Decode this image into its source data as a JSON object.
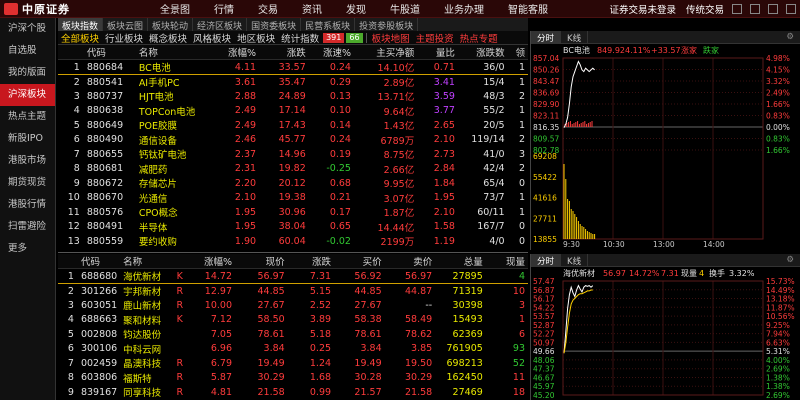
{
  "app": {
    "logo_text": "中原证券",
    "menu": [
      "全景图",
      "行情",
      "交易",
      "资讯",
      "发现",
      "牛股道",
      "业务办理",
      "智能客服"
    ],
    "status": "证券交易未登录",
    "theme": "传统交易"
  },
  "subtabs": [
    "板块指数",
    "板块云图",
    "板块轮动",
    "经济区板块",
    "国资委板块",
    "民营系板块",
    "投资参股板块"
  ],
  "sidebar": [
    "沪深个股",
    "自选股",
    "我的版面",
    "沪深板块",
    "热点主题",
    "新股IPO",
    "港股市场",
    "期货现货",
    "港股行情",
    "扫雷避险",
    "更多"
  ],
  "categories": {
    "items": [
      "全部板块",
      "行业板块",
      "概念板块",
      "风格板块",
      "地区板块",
      "统计指数"
    ],
    "up_count": "391",
    "down_count": "66",
    "extra": [
      "板块地图",
      "主题投资",
      "热点专题"
    ]
  },
  "upper_table": {
    "headers": [
      "",
      "代码",
      "名称",
      "涨幅%",
      "涨跌",
      "涨速%",
      "主买净额",
      "量比",
      "涨跌数",
      "领"
    ],
    "rows": [
      [
        "1",
        "880684",
        "BC电池",
        "4.11",
        "33.57",
        "0.24",
        "14.10亿",
        "0.71",
        "36/0",
        "1"
      ],
      [
        "2",
        "880541",
        "AI手机PC",
        "3.61",
        "35.47",
        "0.29",
        "2.89亿",
        "3.41",
        "15/4",
        "1"
      ],
      [
        "3",
        "880737",
        "HJT电池",
        "2.88",
        "24.89",
        "0.13",
        "13.71亿",
        "3.59",
        "48/3",
        "2"
      ],
      [
        "4",
        "880638",
        "TOPCon电池",
        "2.49",
        "17.14",
        "0.10",
        "9.64亿",
        "3.77",
        "55/2",
        "1"
      ],
      [
        "5",
        "880649",
        "POE胶膜",
        "2.49",
        "17.43",
        "0.14",
        "1.43亿",
        "2.65",
        "20/5",
        "1"
      ],
      [
        "6",
        "880490",
        "通信设备",
        "2.46",
        "45.77",
        "0.24",
        "6789万",
        "2.10",
        "119/14",
        "2"
      ],
      [
        "7",
        "880655",
        "钙钛矿电池",
        "2.37",
        "14.96",
        "0.19",
        "8.75亿",
        "2.73",
        "41/0",
        "3"
      ],
      [
        "8",
        "880681",
        "减肥药",
        "2.31",
        "19.82",
        "-0.25",
        "2.66亿",
        "2.84",
        "42/4",
        "2"
      ],
      [
        "9",
        "880672",
        "存储芯片",
        "2.20",
        "20.12",
        "0.68",
        "9.95亿",
        "1.84",
        "65/4",
        "0"
      ],
      [
        "10",
        "880670",
        "光通信",
        "2.10",
        "19.38",
        "0.21",
        "3.07亿",
        "1.95",
        "73/7",
        "1"
      ],
      [
        "11",
        "880576",
        "CPO概念",
        "1.95",
        "30.96",
        "0.17",
        "1.87亿",
        "2.10",
        "60/11",
        "1"
      ],
      [
        "12",
        "880491",
        "半导体",
        "1.95",
        "38.04",
        "0.65",
        "14.44亿",
        "1.58",
        "167/7",
        "0"
      ],
      [
        "13",
        "880559",
        "要约收购",
        "1.90",
        "60.04",
        "-0.02",
        "2199万",
        "1.19",
        "4/0",
        "0"
      ]
    ]
  },
  "lower_table": {
    "headers": [
      "",
      "代码",
      "名称",
      "",
      "涨幅%",
      "现价",
      "涨跌",
      "买价",
      "卖价",
      "总量",
      "现量"
    ],
    "rows": [
      [
        "1",
        "688680",
        "海优新材",
        "K",
        "14.72",
        "56.97",
        "7.31",
        "56.92",
        "56.97",
        "27895",
        "4"
      ],
      [
        "2",
        "301266",
        "宇邦新材",
        "R",
        "12.97",
        "44.85",
        "5.15",
        "44.85",
        "44.87",
        "71319",
        "10"
      ],
      [
        "3",
        "603051",
        "鹿山新材",
        "R",
        "10.00",
        "27.67",
        "2.52",
        "27.67",
        "--",
        "30398",
        "3"
      ],
      [
        "4",
        "688663",
        "聚和材料",
        "K",
        "7.12",
        "58.50",
        "3.89",
        "58.38",
        "58.49",
        "15493",
        "1"
      ],
      [
        "5",
        "002808",
        "钧达股份",
        "",
        "7.05",
        "78.61",
        "5.18",
        "78.61",
        "78.62",
        "62369",
        "6"
      ],
      [
        "6",
        "300106",
        "中科云网",
        "",
        "6.96",
        "3.84",
        "0.25",
        "3.84",
        "3.85",
        "761905",
        "93"
      ],
      [
        "7",
        "002459",
        "晶澳科技",
        "R",
        "6.79",
        "19.49",
        "1.24",
        "19.49",
        "19.50",
        "698213",
        "52"
      ],
      [
        "8",
        "603806",
        "福斯特",
        "R",
        "5.87",
        "30.29",
        "1.68",
        "30.28",
        "30.29",
        "162450",
        "11"
      ],
      [
        "9",
        "839167",
        "同享科技",
        "R",
        "4.81",
        "21.58",
        "0.99",
        "21.57",
        "21.58",
        "27469",
        "18"
      ]
    ]
  },
  "chart1": {
    "tabs": [
      "分时",
      "K线"
    ],
    "name": "BC电池",
    "price": "849.92",
    "pct": "4.11%",
    "chg": "+33.57",
    "label_up": "涨家",
    "label_down": "跌家",
    "y_left": [
      "857.04",
      "850.26",
      "843.47",
      "836.69",
      "829.90",
      "823.11",
      "816.35",
      "809.57",
      "802.78"
    ],
    "y_right": [
      "4.98%",
      "4.15%",
      "3.32%",
      "2.49%",
      "1.66%",
      "0.83%",
      "0.00%",
      "0.83%",
      "1.66%"
    ],
    "vol_labels": [
      "69208",
      "55422",
      "41616",
      "27711",
      "13855"
    ],
    "time_labels": [
      "9:30",
      "10:30",
      "13:00",
      "14:00"
    ]
  },
  "chart2": {
    "tabs": [
      "分时",
      "K线"
    ],
    "name": "海优新材",
    "price": "56.97",
    "pct": "14.72%",
    "chg": "7.31",
    "vol_label": "现量",
    "vol": "4",
    "turnover_label": "换手",
    "turnover": "3.32%",
    "y_left": [
      "57.47",
      "56.87",
      "56.17",
      "54.22",
      "53.57",
      "52.87",
      "52.27",
      "50.97",
      "49.66",
      "48.06",
      "47.37",
      "46.67",
      "45.97",
      "45.20"
    ],
    "y_right": [
      "15.73%",
      "14.49%",
      "13.18%",
      "11.87%",
      "10.56%",
      "9.25%",
      "7.94%",
      "6.63%",
      "5.31%",
      "4.00%",
      "2.69%",
      "1.38%",
      "1.38%",
      "2.69%"
    ]
  }
}
